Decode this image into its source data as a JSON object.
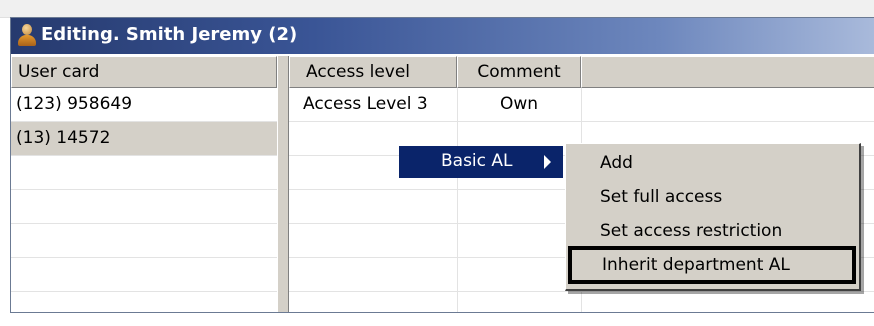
{
  "window": {
    "title": "Editing. Smith Jeremy (2)",
    "icon": "user-icon",
    "colors": {
      "title_start": "#263a6e",
      "title_end": "#a9badb",
      "selection": "#0a246a"
    }
  },
  "left_table": {
    "header": "User card",
    "rows": [
      "(123) 958649",
      "(13) 14572"
    ],
    "selected_index": 1
  },
  "right_table": {
    "headers": [
      "Access level",
      "Comment"
    ],
    "rows": [
      {
        "access_level": "Access Level 3",
        "comment": "Own"
      }
    ]
  },
  "context_menu": {
    "active_item": "Basic AL",
    "submenu_icon": "chevron-right-icon",
    "submenu": [
      "Add",
      "Set full access",
      "Set access restriction",
      "Inherit department AL"
    ],
    "highlighted_submenu_item": "Inherit department AL"
  }
}
